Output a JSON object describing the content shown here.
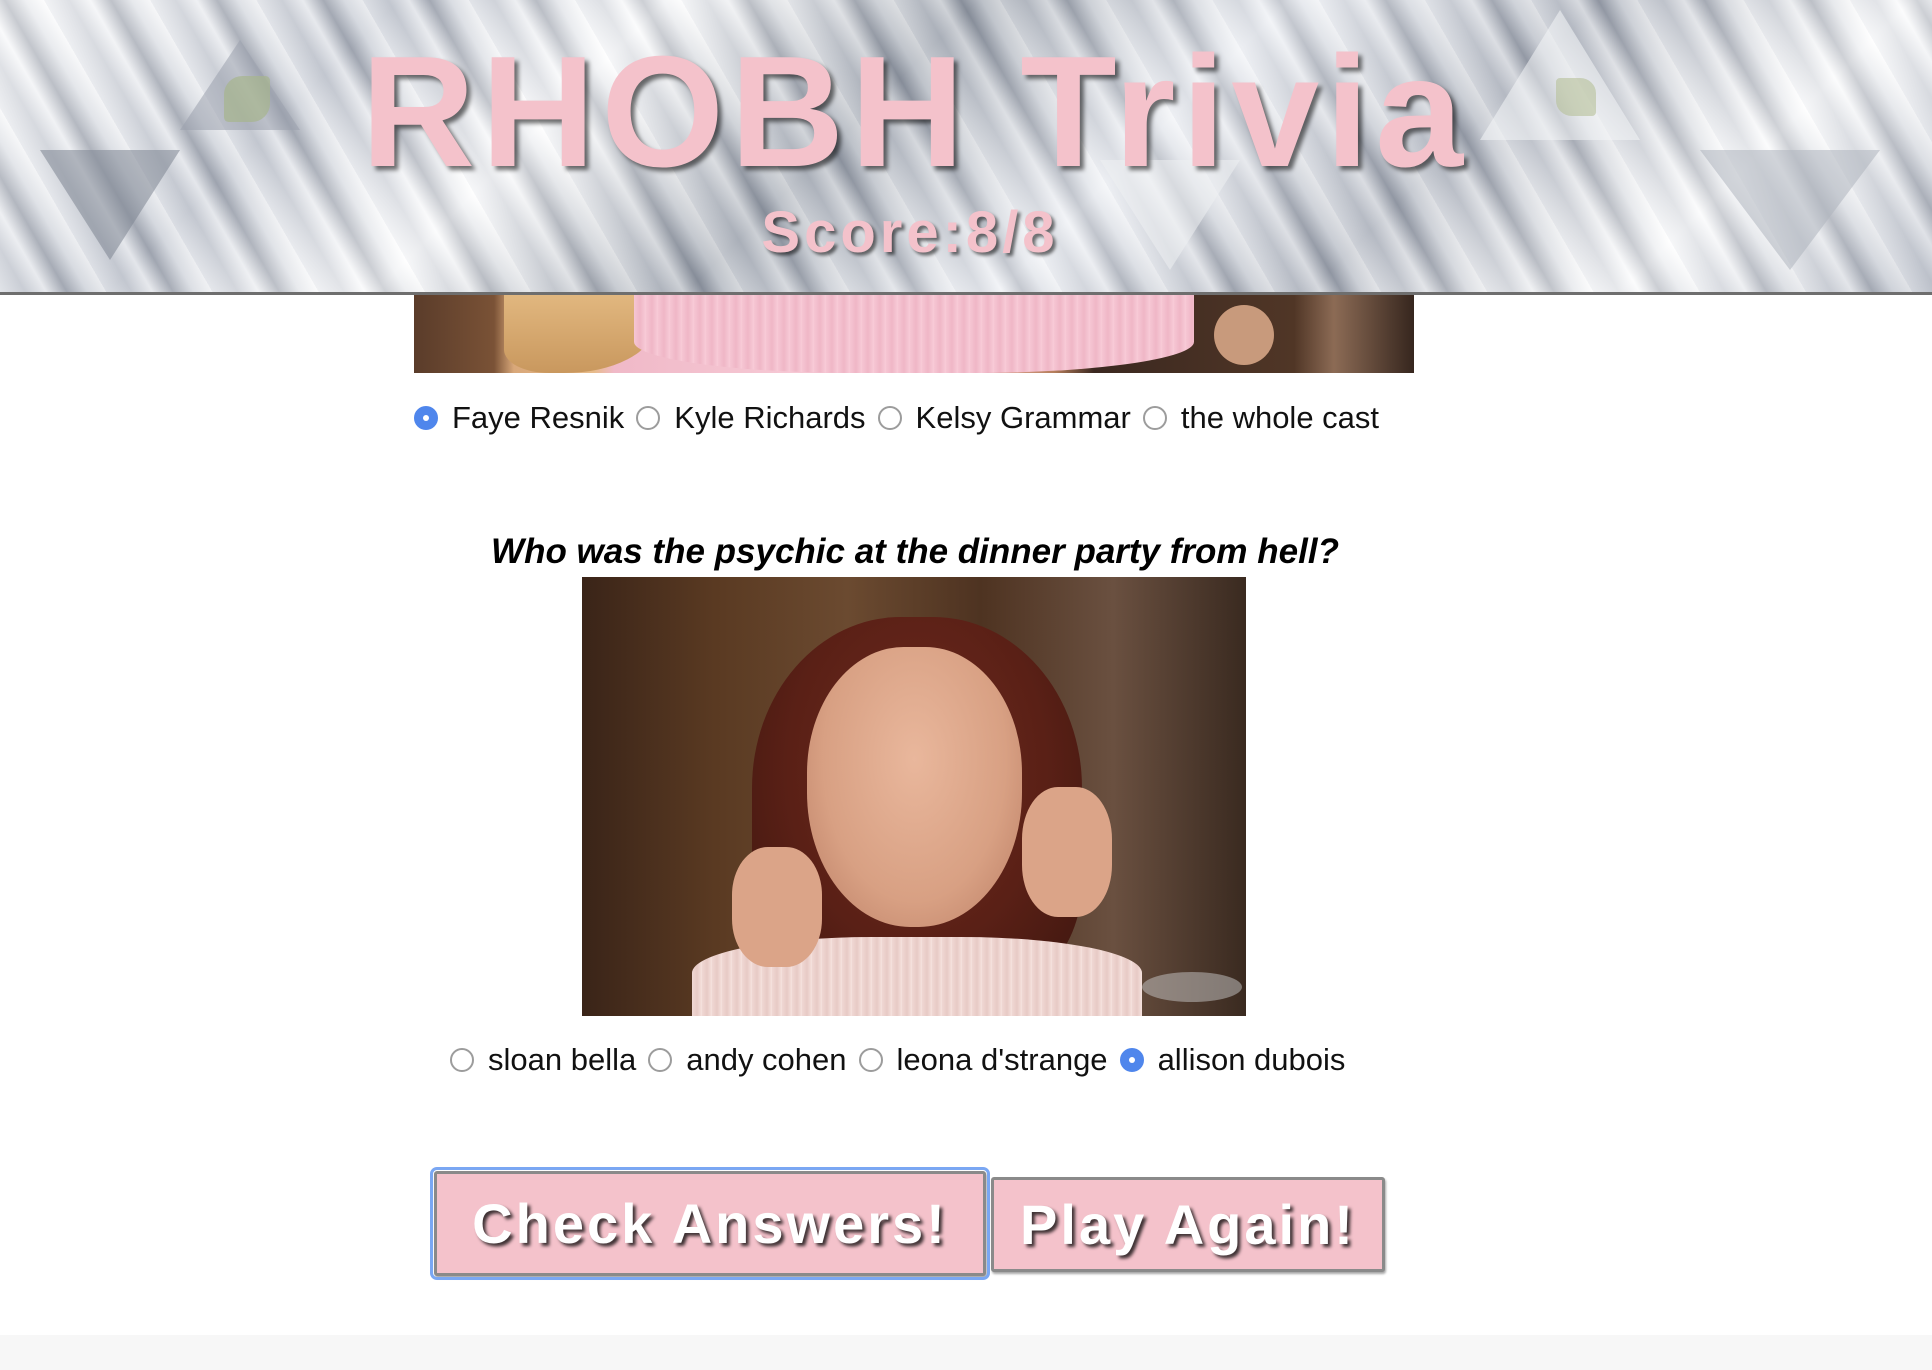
{
  "header": {
    "title": "RHOBH Trivia",
    "score": "Score:8/8"
  },
  "question1": {
    "options": [
      {
        "label": "Faye Resnik",
        "checked": true
      },
      {
        "label": "Kyle Richards",
        "checked": false
      },
      {
        "label": "Kelsy Grammar",
        "checked": false
      },
      {
        "label": "the whole cast",
        "checked": false
      }
    ]
  },
  "question2": {
    "text": "Who was the psychic at the dinner party from hell?",
    "options": [
      {
        "label": "sloan bella",
        "checked": false
      },
      {
        "label": "andy cohen",
        "checked": false
      },
      {
        "label": "leona d'strange",
        "checked": false
      },
      {
        "label": "allison dubois",
        "checked": true
      }
    ]
  },
  "buttons": {
    "check": "Check Answers!",
    "play": "Play Again!"
  },
  "colors": {
    "accent_pink": "#f4c2cb",
    "radio_checked": "#4f86ec",
    "focus_ring": "#7aa7f3"
  }
}
